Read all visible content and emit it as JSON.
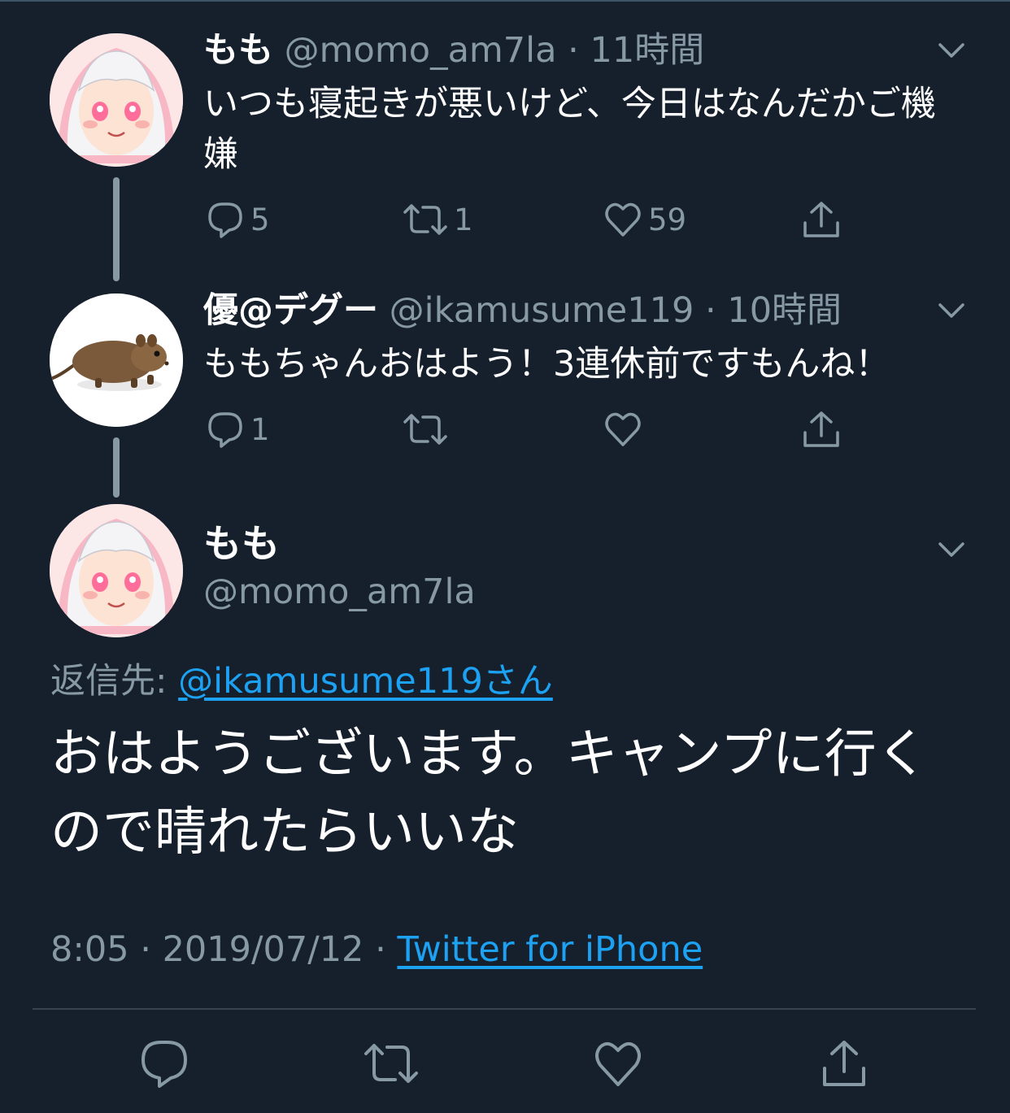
{
  "colors": {
    "background": "#16202c",
    "text": "#ffffff",
    "secondary": "#8899a6",
    "link": "#1da1f2",
    "divider": "#38444d"
  },
  "tweets": [
    {
      "display_name": "もも",
      "handle": "@momo_am7la",
      "separator": "·",
      "time": "11時間",
      "text": "いつも寝起きが悪いけど、今日はなんだかご機嫌",
      "actions": {
        "reply_count": "5",
        "retweet_count": "1",
        "like_count": "59"
      },
      "avatar_icon": "anime-girl-avatar"
    },
    {
      "display_name": "優@デグー",
      "handle": "@ikamusume119",
      "separator": "·",
      "time": "10時間",
      "text": "ももちゃんおはよう！3連休前ですもんね！",
      "actions": {
        "reply_count": "1",
        "retweet_count": "",
        "like_count": ""
      },
      "avatar_icon": "degu-avatar"
    }
  ],
  "main_tweet": {
    "display_name": "もも",
    "handle": "@momo_am7la",
    "reply_label": "返信先: ",
    "reply_mention": "@ikamusume119さん",
    "text": "おはようございます。キャンプに行くので晴れたらいいな",
    "time": "8:05",
    "date": "2019/07/12",
    "separator": "·",
    "source": "Twitter for iPhone"
  },
  "icons": {
    "reply": "reply-icon",
    "retweet": "retweet-icon",
    "like": "heart-icon",
    "share": "share-icon",
    "menu": "chevron-down-icon"
  }
}
